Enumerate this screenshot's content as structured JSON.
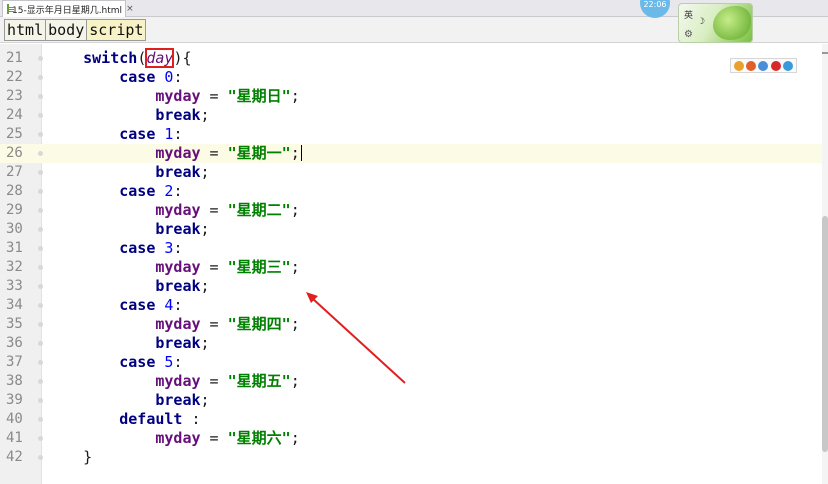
{
  "tab": {
    "label": "15-显示年月日星期几.html",
    "close": "×"
  },
  "breadcrumbs": [
    "html",
    "body",
    "script"
  ],
  "clock": {
    "time": "22:06"
  },
  "ime": {
    "lang": "英",
    "gear": "⚙",
    "mode": "☽",
    "dot": ":"
  },
  "editor": {
    "current_line": 26,
    "lines": [
      {
        "n": "21",
        "indent": "    ",
        "tokens": [
          [
            "kw-plain",
            "switch"
          ],
          [
            "plain",
            "("
          ],
          [
            "ident-box",
            "day"
          ],
          [
            "plain",
            "){"
          ]
        ]
      },
      {
        "n": "22",
        "indent": "        ",
        "tokens": [
          [
            "kw",
            "case"
          ],
          [
            "plain",
            " "
          ],
          [
            "num",
            "0"
          ],
          [
            "plain",
            ":"
          ]
        ]
      },
      {
        "n": "23",
        "indent": "            ",
        "tokens": [
          [
            "var",
            "myday"
          ],
          [
            "plain",
            " = "
          ],
          [
            "str",
            "\"星期日\""
          ],
          [
            "plain",
            ";"
          ]
        ]
      },
      {
        "n": "24",
        "indent": "            ",
        "tokens": [
          [
            "kw",
            "break"
          ],
          [
            "plain",
            ";"
          ]
        ]
      },
      {
        "n": "25",
        "indent": "        ",
        "tokens": [
          [
            "kw",
            "case"
          ],
          [
            "plain",
            " "
          ],
          [
            "num",
            "1"
          ],
          [
            "plain",
            ":"
          ]
        ]
      },
      {
        "n": "26",
        "indent": "            ",
        "tokens": [
          [
            "var",
            "myday"
          ],
          [
            "plain",
            " = "
          ],
          [
            "str",
            "\"星期一\""
          ],
          [
            "plain",
            ";"
          ],
          [
            "caret",
            ""
          ]
        ]
      },
      {
        "n": "27",
        "indent": "            ",
        "tokens": [
          [
            "kw",
            "break"
          ],
          [
            "plain",
            ";"
          ]
        ]
      },
      {
        "n": "28",
        "indent": "        ",
        "tokens": [
          [
            "kw",
            "case"
          ],
          [
            "plain",
            " "
          ],
          [
            "num",
            "2"
          ],
          [
            "plain",
            ":"
          ]
        ]
      },
      {
        "n": "29",
        "indent": "            ",
        "tokens": [
          [
            "var",
            "myday"
          ],
          [
            "plain",
            " = "
          ],
          [
            "str",
            "\"星期二\""
          ],
          [
            "plain",
            ";"
          ]
        ]
      },
      {
        "n": "30",
        "indent": "            ",
        "tokens": [
          [
            "kw",
            "break"
          ],
          [
            "plain",
            ";"
          ]
        ]
      },
      {
        "n": "31",
        "indent": "        ",
        "tokens": [
          [
            "kw",
            "case"
          ],
          [
            "plain",
            " "
          ],
          [
            "num",
            "3"
          ],
          [
            "plain",
            ":"
          ]
        ]
      },
      {
        "n": "32",
        "indent": "            ",
        "tokens": [
          [
            "var",
            "myday"
          ],
          [
            "plain",
            " = "
          ],
          [
            "str",
            "\"星期三\""
          ],
          [
            "plain",
            ";"
          ]
        ]
      },
      {
        "n": "33",
        "indent": "            ",
        "tokens": [
          [
            "kw",
            "break"
          ],
          [
            "plain",
            ";"
          ]
        ]
      },
      {
        "n": "34",
        "indent": "        ",
        "tokens": [
          [
            "kw",
            "case"
          ],
          [
            "plain",
            " "
          ],
          [
            "num",
            "4"
          ],
          [
            "plain",
            ":"
          ]
        ]
      },
      {
        "n": "35",
        "indent": "            ",
        "tokens": [
          [
            "var",
            "myday"
          ],
          [
            "plain",
            " = "
          ],
          [
            "str",
            "\"星期四\""
          ],
          [
            "plain",
            ";"
          ]
        ]
      },
      {
        "n": "36",
        "indent": "            ",
        "tokens": [
          [
            "kw",
            "break"
          ],
          [
            "plain",
            ";"
          ]
        ]
      },
      {
        "n": "37",
        "indent": "        ",
        "tokens": [
          [
            "kw",
            "case"
          ],
          [
            "plain",
            " "
          ],
          [
            "num",
            "5"
          ],
          [
            "plain",
            ":"
          ]
        ]
      },
      {
        "n": "38",
        "indent": "            ",
        "tokens": [
          [
            "var",
            "myday"
          ],
          [
            "plain",
            " = "
          ],
          [
            "str",
            "\"星期五\""
          ],
          [
            "plain",
            ";"
          ]
        ]
      },
      {
        "n": "39",
        "indent": "            ",
        "tokens": [
          [
            "kw",
            "break"
          ],
          [
            "plain",
            ";"
          ]
        ]
      },
      {
        "n": "40",
        "indent": "        ",
        "tokens": [
          [
            "kw",
            "default"
          ],
          [
            "plain",
            " :"
          ]
        ]
      },
      {
        "n": "41",
        "indent": "            ",
        "tokens": [
          [
            "var",
            "myday"
          ],
          [
            "plain",
            " = "
          ],
          [
            "str",
            "\"星期六\""
          ],
          [
            "plain",
            ";"
          ]
        ]
      },
      {
        "n": "42",
        "indent": "    ",
        "tokens": [
          [
            "plain",
            "}"
          ]
        ]
      }
    ]
  },
  "browser_icons": [
    {
      "name": "chrome-icon",
      "color": "#e8a12c"
    },
    {
      "name": "firefox-icon",
      "color": "#e0602a"
    },
    {
      "name": "safari-icon",
      "color": "#4a8fd6"
    },
    {
      "name": "opera-icon",
      "color": "#d8282a"
    },
    {
      "name": "ie-icon",
      "color": "#3a9ad9"
    }
  ],
  "colors": {
    "annotation": "#e02020",
    "keyword": "#000080",
    "string": "#008000",
    "variable": "#660e7a",
    "number": "#0000ff"
  }
}
